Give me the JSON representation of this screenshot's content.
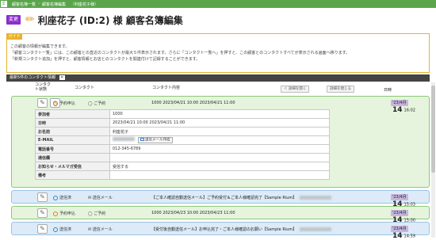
{
  "breadcrumb": {
    "home_label": "E",
    "items": [
      "顧客名簿一覧",
      "顧客名簿編集",
      "（利座花子様）"
    ]
  },
  "header": {
    "mode_label": "変更",
    "pencil_icon": "pencil-icon",
    "title": "利座花子 (ID:2) 様 顧客名簿編集"
  },
  "guide": {
    "tag": "ガイド",
    "lines": [
      "この顧客の情報が編集できます。",
      "「顧客コンタクト一覧」には、この顧客との直近のコンタクトが最大５件表示されます。さらに「コンタクト一覧へ」を押すと、この顧客とのコンタクトすべてが表示される画面へ移ります。",
      "「新規コンタクト追加」を押すと、顧客情報とお店とのコンタクトを関連付けて記録することができます。"
    ]
  },
  "contacts_panel": {
    "title": "最新5件のコンタクト情報",
    "collapse_icon": "collapse-icon",
    "columns": {
      "contact_status": "コンタクト状態",
      "contact": "コンタクト",
      "contact_content": "コンタクト内容",
      "date": "日時"
    },
    "prev_button": "＜ 詳細を開く",
    "next_button": "詳細を閉じる"
  },
  "rows": [
    {
      "color": "green",
      "status": "予約申込",
      "status_color": "#e07b1a",
      "kind": "ご予約",
      "content": "1000 2023/04/21 10:00 2023/04/21 11:00",
      "month": "'23/4月",
      "day": "14",
      "time": "16:02",
      "expanded": true,
      "details": [
        {
          "k": "参加者",
          "v": "1000"
        },
        {
          "k": "日時",
          "v": "2023/04/21 10:00 2023/04/21 11:00"
        },
        {
          "k": "お名前",
          "v": "利座花子"
        },
        {
          "k": "E-MAIL",
          "v": "",
          "mail_button": "送信メール作成"
        },
        {
          "k": "電話番号",
          "v": "012-345-6789"
        },
        {
          "k": "通信欄",
          "v": ""
        },
        {
          "k": "お知らせ・メルマガ受信",
          "v": "受信する"
        },
        {
          "k": "備考",
          "v": ""
        }
      ]
    },
    {
      "color": "blue",
      "status": "送信済",
      "status_color": "#3a82c4",
      "kind": "送信メール",
      "content": "【ご本人確認自動送信メール】ご予約受付＆ご本人様確認完了【Sample Rium】",
      "month": "'23/4月",
      "day": "14",
      "time": "15:03"
    },
    {
      "color": "green",
      "status": "予約申込",
      "status_color": "#e07b1a",
      "kind": "ご予約",
      "content": "1000 2023/04/23 10:00 2023/04/23 11:00",
      "month": "'23/4月",
      "day": "14",
      "time": "15:00"
    },
    {
      "color": "blue",
      "status": "送信済",
      "status_color": "#3a82c4",
      "kind": "送信メール",
      "content": "【受付後自動送信メール】お申込完了・ご本人様確認のお願い【Sample Rium】",
      "month": "'23/4月",
      "day": "14",
      "time": "14:59"
    }
  ]
}
